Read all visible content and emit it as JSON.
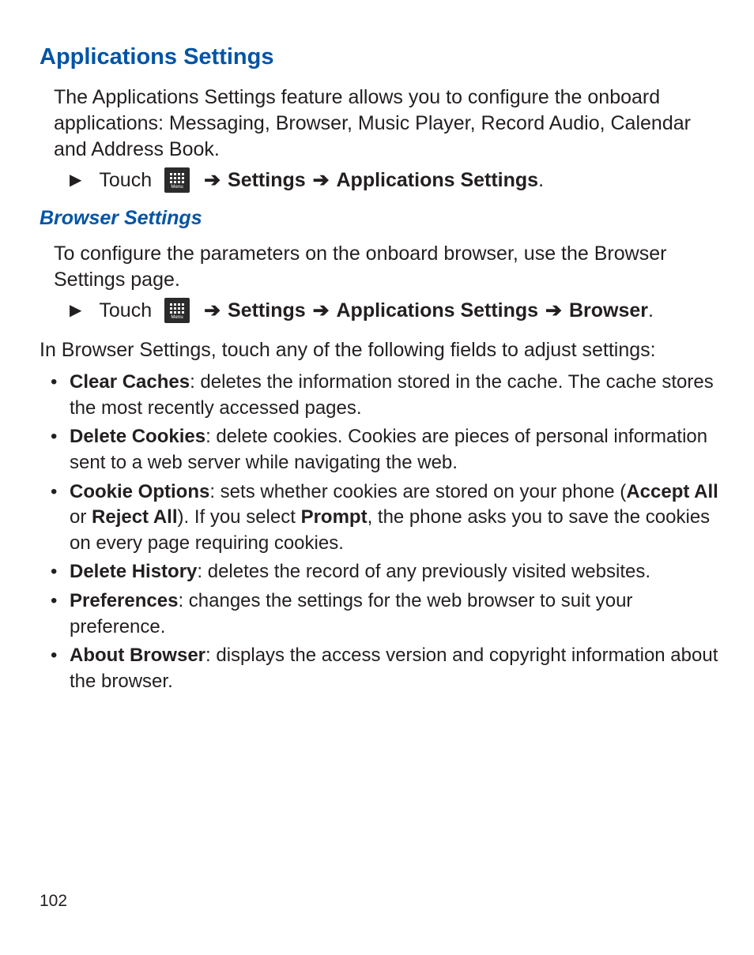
{
  "h1": "Applications Settings",
  "intro": "The Applications Settings feature allows you to configure the onboard applications: Messaging, Browser, Music Player, Record Audio, Calendar and Address Book.",
  "touch_word": "Touch",
  "menu_label": "Menu",
  "arrow": "➔",
  "nav1": {
    "settings": "Settings",
    "apps": "Applications Settings",
    "period": "."
  },
  "h2": "Browser Settings",
  "browser_intro": "To configure the parameters on the onboard browser, use the Browser Settings page.",
  "nav2": {
    "settings": "Settings",
    "apps": "Applications Settings",
    "browser": "Browser",
    "period": "."
  },
  "browser_lead": "In Browser Settings, touch any of the following fields to adjust settings:",
  "bullets": [
    {
      "t": "Clear Caches",
      "d": ": deletes the information stored in the cache. The cache stores the most recently accessed pages."
    },
    {
      "t": "Delete Cookies",
      "d": ": delete cookies. Cookies are pieces of personal information sent to a web server while navigating the web."
    },
    {
      "t": "Cookie Options",
      "segments": [
        {
          "text": ": sets whether cookies are stored on your phone ("
        },
        {
          "text": "Accept All",
          "bold": true
        },
        {
          "text": " or "
        },
        {
          "text": "Reject All",
          "bold": true
        },
        {
          "text": "). If you select "
        },
        {
          "text": "Prompt",
          "bold": true
        },
        {
          "text": ", the phone asks you to save the cookies on every page requiring cookies."
        }
      ]
    },
    {
      "t": "Delete History",
      "d": ": deletes the record of any previously visited websites."
    },
    {
      "t": "Preferences",
      "d": ": changes the settings for the web browser to suit your preference."
    },
    {
      "t": "About Browser",
      "d": ": displays the access version and copyright information about the browser."
    }
  ],
  "page_num": "102"
}
